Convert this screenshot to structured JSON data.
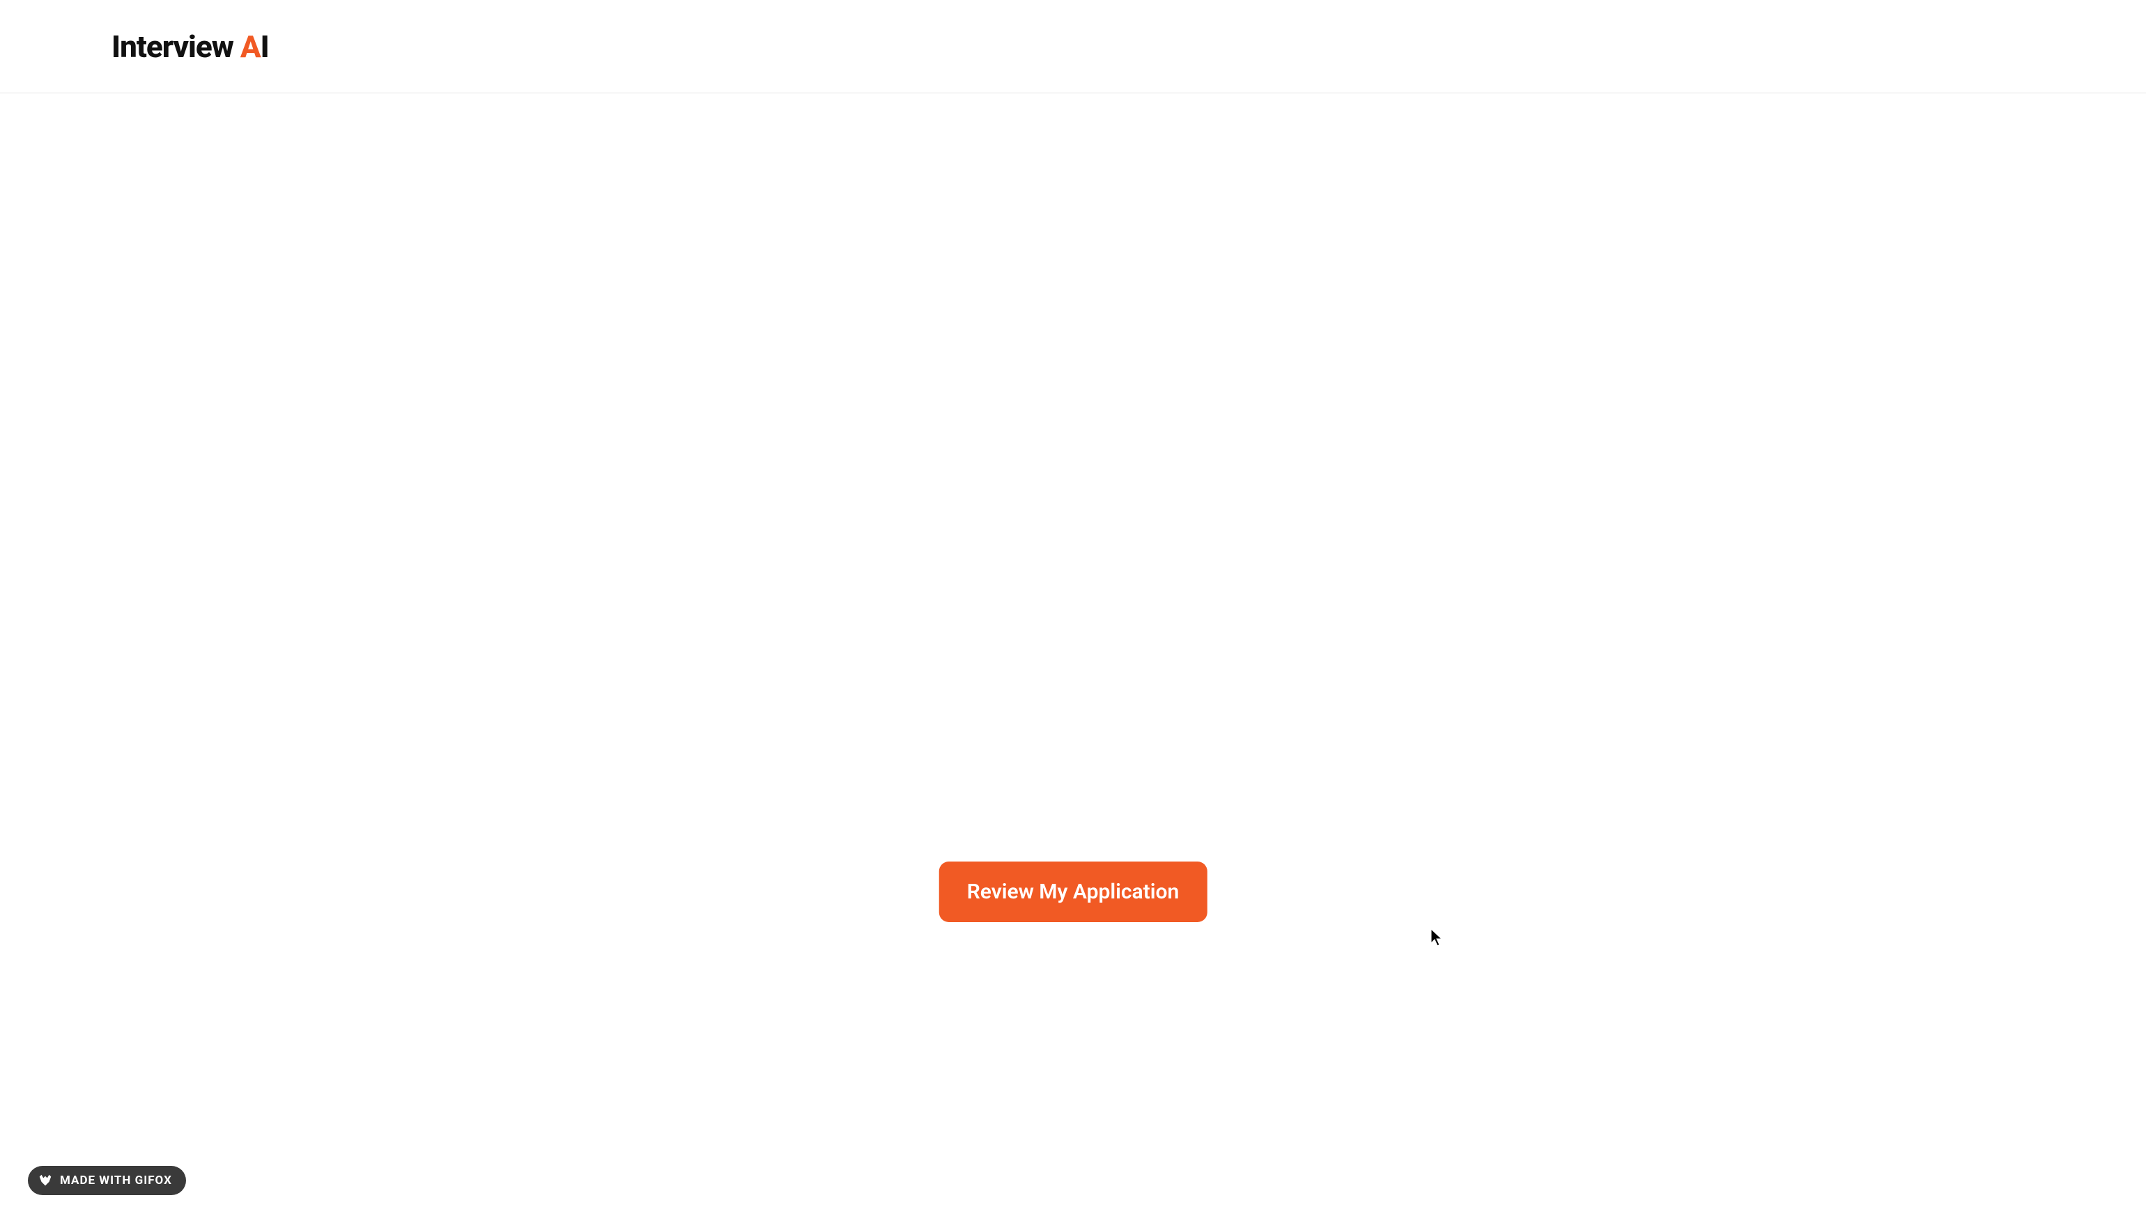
{
  "header": {
    "logo_part1": "Interview",
    "logo_part2": "A",
    "logo_part3": "I"
  },
  "main": {
    "review_button_label": "Review My Application"
  },
  "watermark": {
    "text": "MADE WITH GIFOX"
  },
  "colors": {
    "accent": "#f15a24",
    "text_dark": "#111111",
    "border": "#e5e5e5",
    "watermark_bg": "#3a3a3a"
  }
}
